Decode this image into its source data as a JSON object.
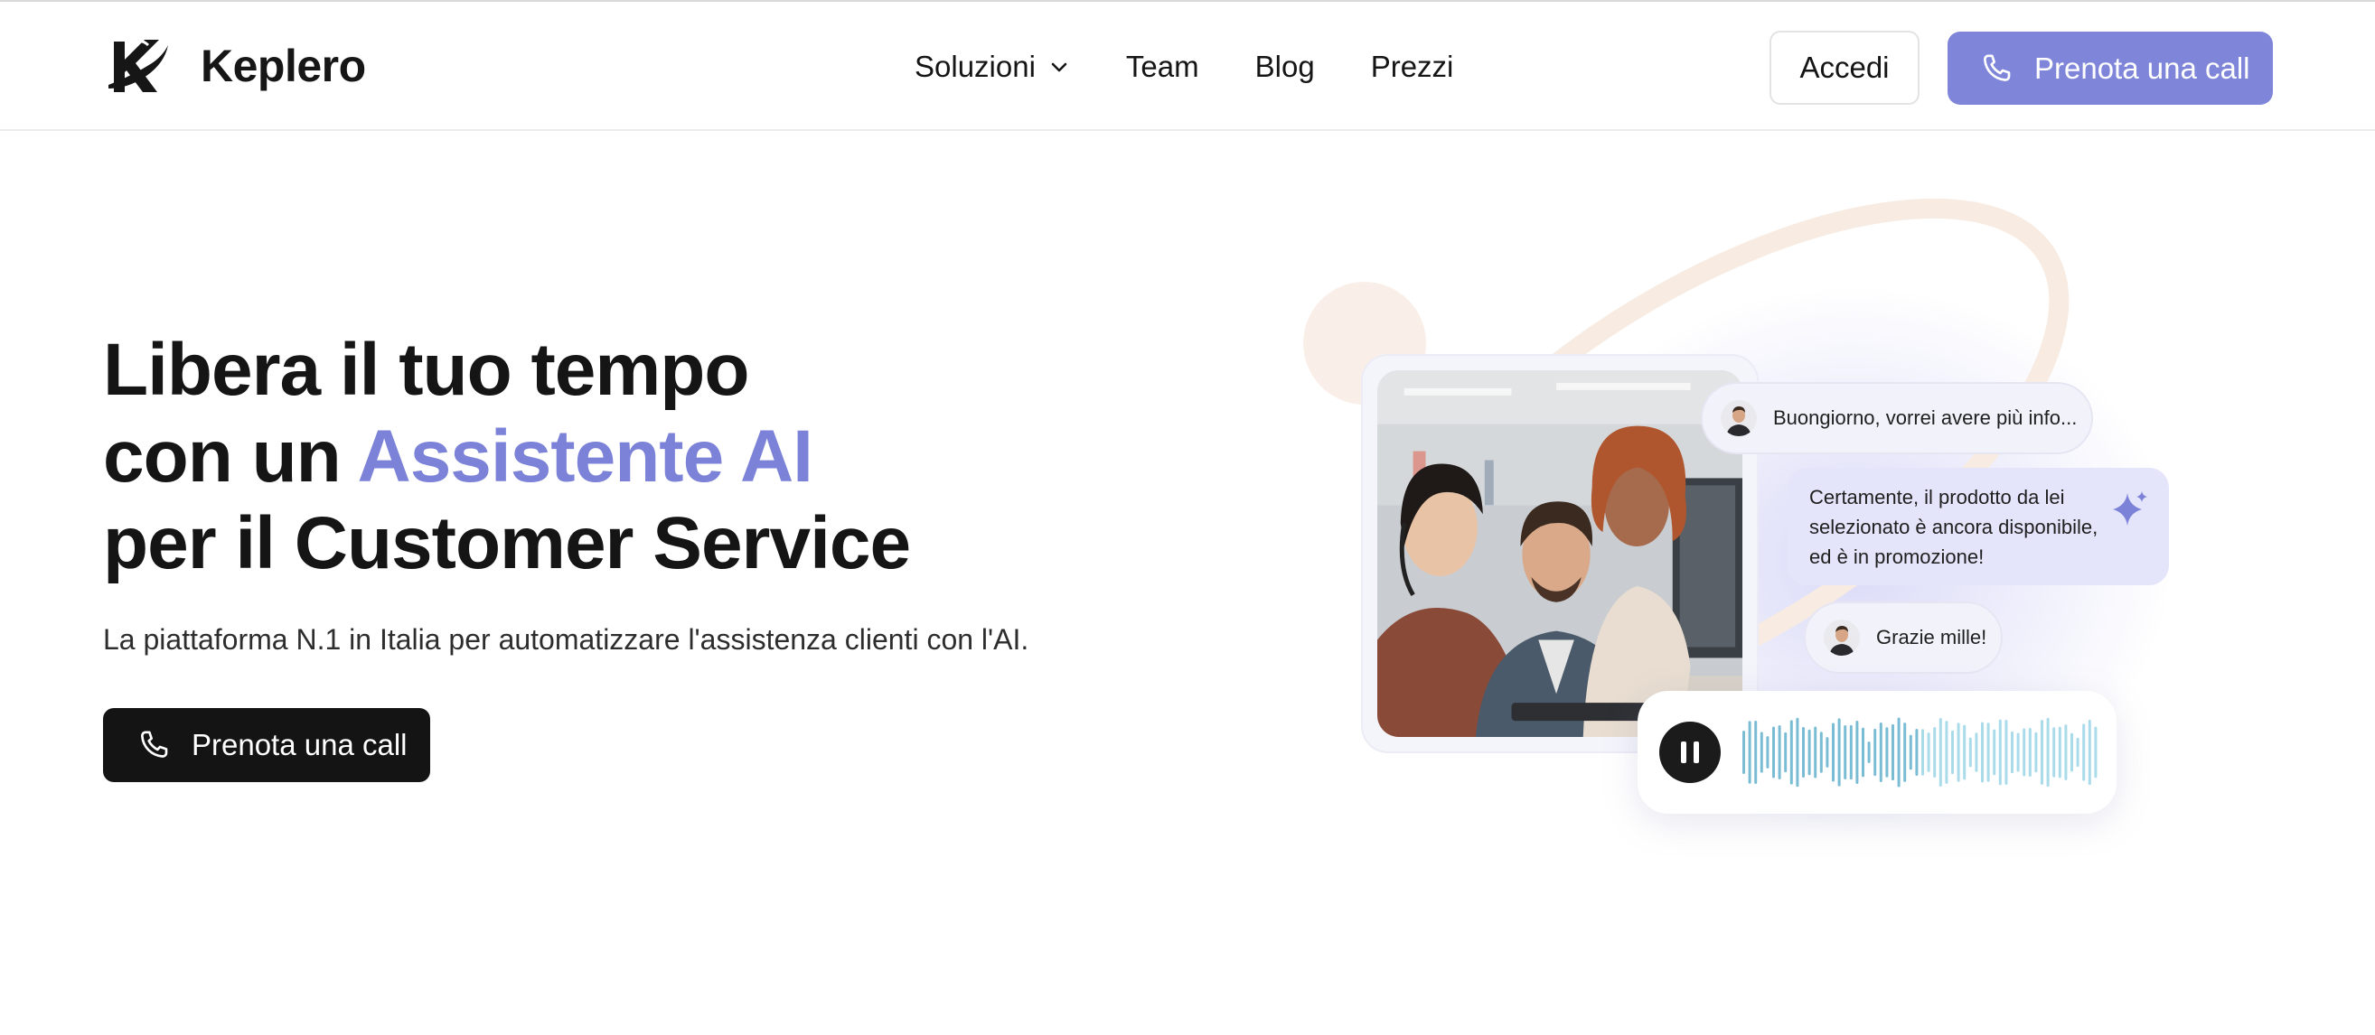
{
  "brand": {
    "name": "Keplero"
  },
  "nav": {
    "items": [
      {
        "label": "Soluzioni",
        "has_dropdown": true
      },
      {
        "label": "Team"
      },
      {
        "label": "Blog"
      },
      {
        "label": "Prezzi"
      }
    ],
    "login_label": "Accedi",
    "cta_label": "Prenota una call"
  },
  "hero": {
    "title_line1": "Libera il tuo tempo",
    "title_line2_pre": "con un ",
    "title_line2_accent": "Assistente AI",
    "title_line3": "per il Customer Service",
    "subtitle": "La piattaforma N.1 in Italia per automatizzare l'assistenza clienti con l'AI.",
    "cta_label": "Prenota una call"
  },
  "illustration": {
    "chat": [
      {
        "from": "user",
        "text": "Buongiorno, vorrei avere più info..."
      },
      {
        "from": "assistant",
        "text": "Certamente, il prodotto da lei selezionato è ancora disponibile, ed è in promozione!"
      },
      {
        "from": "user",
        "text": "Grazie mille!"
      }
    ],
    "player_state": "playing"
  },
  "colors": {
    "accent": "#7b82d8",
    "cta_top": "#7f86da",
    "cta_hero": "#141414",
    "wave": "#7fbfd6"
  },
  "icons": [
    "logo-mark",
    "chevron-down-icon",
    "phone-icon",
    "sparkle-icon",
    "pause-icon"
  ]
}
